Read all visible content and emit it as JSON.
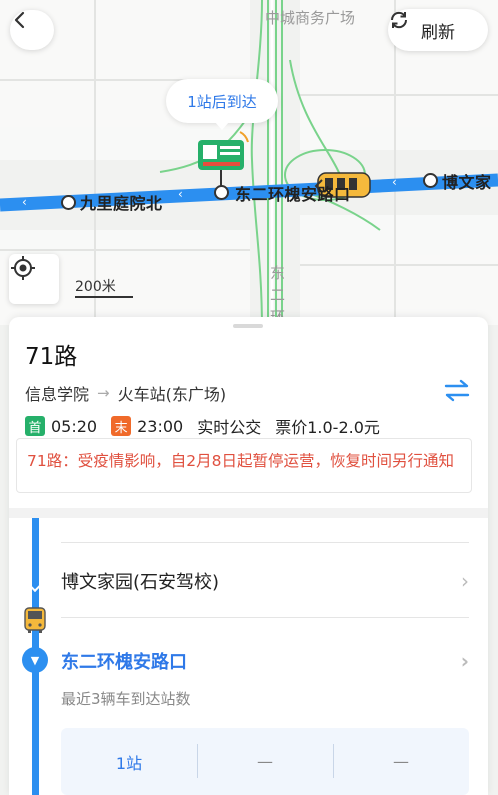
{
  "map": {
    "labels": {
      "top_landmark": "中城商务广场",
      "road_vertical": "东二环",
      "stop_left": "九里庭院北",
      "stop_center": "东二环槐安路口",
      "stop_right": "博文家"
    },
    "arrival_bubble": "1站后到达",
    "scale": "200米",
    "route_color": "#2c8ff0",
    "road_color": "#7dd88a"
  },
  "header": {
    "back_icon": "chevron-left-icon",
    "refresh_label": "刷新",
    "refresh_icon": "refresh-icon"
  },
  "route": {
    "name": "71路",
    "from": "信息学院",
    "to": "火车站(东广场)",
    "first_tag": "首",
    "first_time": "05:20",
    "last_tag": "末",
    "last_time": "23:00",
    "realtime": "实时公交",
    "fare": "票价1.0-2.0元",
    "notice": "71路：受疫情影响，自2月8日起暂停运营，恢复时间另行通知"
  },
  "stops": [
    {
      "name": "博文家园(石安驾校)"
    },
    {
      "name": "东二环槐安路口",
      "sub": "最近3辆车到达站数"
    }
  ],
  "eta": [
    "1站",
    "—",
    "—"
  ]
}
